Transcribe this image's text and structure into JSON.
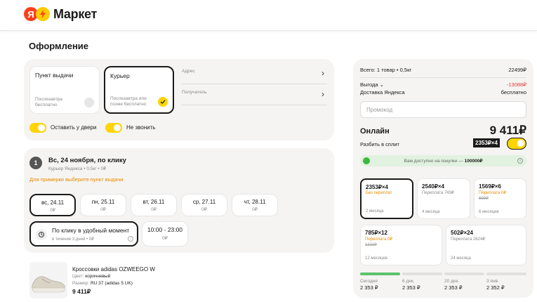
{
  "header": {
    "logo_letter": "Я",
    "logo_text": "Маркет"
  },
  "page": {
    "title": "Оформление"
  },
  "delivery": {
    "methods": [
      {
        "title": "Пункт выдачи",
        "subtitle": "Послезавтра бесплатно",
        "selected": false
      },
      {
        "title": "Курьер",
        "subtitle": "Послезавтра или позже бесплатно",
        "selected": true
      }
    ],
    "address_label": "Адрес",
    "recipient_label": "Получатель",
    "toggles": [
      {
        "label": "Оставить у двери",
        "on": true
      },
      {
        "label": "Не звонить",
        "on": true
      }
    ]
  },
  "shipment": {
    "number": "1",
    "title": "Вс, 24 ноября, по клику",
    "subtitle": "Курьер Яндекса • 0,5кг • 0₽",
    "warning": "Для примерки выберите пункт выдачи",
    "days": [
      {
        "date": "вс, 24.11",
        "price": "0₽",
        "selected": true
      },
      {
        "date": "пн, 25.11",
        "price": "0₽",
        "selected": false
      },
      {
        "date": "вт, 26.11",
        "price": "0₽",
        "selected": false
      },
      {
        "date": "ср, 27.11",
        "price": "0₽",
        "selected": false
      },
      {
        "date": "чт, 28.11",
        "price": "0₽",
        "selected": false
      }
    ],
    "click_option": {
      "title": "По клику в удобный момент",
      "subtitle": "в течение 3 дней • 0₽",
      "info": "i"
    },
    "time_option": {
      "time": "10:00 - 23:00",
      "price": "0₽"
    }
  },
  "product": {
    "name": "Кроссовки adidas OZWEEGO W",
    "color_label": "Цвет:",
    "color_value": "коричневый",
    "size_label": "Размер:",
    "size_value": "RU 37 (adidas 5 UK)",
    "price": "9 411₽"
  },
  "summary": {
    "total_label": "Всего: 1 товар • 0,5кг",
    "total_value": "22499₽",
    "benefit_label": "Выгода ⌄",
    "benefit_value": "-13088₽",
    "delivery_label": "Доставка Яндекса",
    "delivery_value": "бесплатно",
    "promo_placeholder": "Промокод",
    "online_label": "Онлайн",
    "online_value": "9 411₽",
    "split_label": "Разбить в сплит",
    "split_badge": "2353₽×4",
    "available_text": "Вам доступно на покупки —",
    "available_amount": "100000₽",
    "available_info": "i",
    "plans": [
      {
        "value": "2353₽×4",
        "overpay": "Без переплат",
        "old": "",
        "months": "2 месяца",
        "selected": true,
        "overpay_color": "#e88a00"
      },
      {
        "value": "2540₽×4",
        "overpay": "Переплата 749₽",
        "old": "",
        "months": "4 месяца",
        "selected": false,
        "overpay_color": "#888888"
      },
      {
        "value": "1569₽×6",
        "overpay": "Переплата 0₽",
        "old": "699₽",
        "months": "6 месяцев",
        "selected": false,
        "overpay_color": "#e88a00"
      },
      {
        "value": "785₽×12",
        "overpay": "Переплата 0₽",
        "old": "1311₽",
        "months": "12 месяцев",
        "selected": false,
        "overpay_color": "#e88a00"
      },
      {
        "value": "502₽×24",
        "overpay": "Переплата 2624₽",
        "old": "",
        "months": "24 месяца",
        "selected": false,
        "overpay_color": "#888888"
      }
    ],
    "schedule": [
      {
        "label": "Сегодня",
        "amount": "2 353 ₽",
        "paid": true
      },
      {
        "label": "6 дек.",
        "amount": "2 353 ₽",
        "paid": false
      },
      {
        "label": "20 дек.",
        "amount": "2 353 ₽",
        "paid": false
      },
      {
        "label": "3 янв.",
        "amount": "2 352 ₽",
        "paid": false
      }
    ]
  },
  "colors": {
    "accent": "#ffd500",
    "warning": "#e88a00",
    "discount": "#e53935",
    "brand_red": "#fc3f1d",
    "green": "#5ec26a"
  }
}
